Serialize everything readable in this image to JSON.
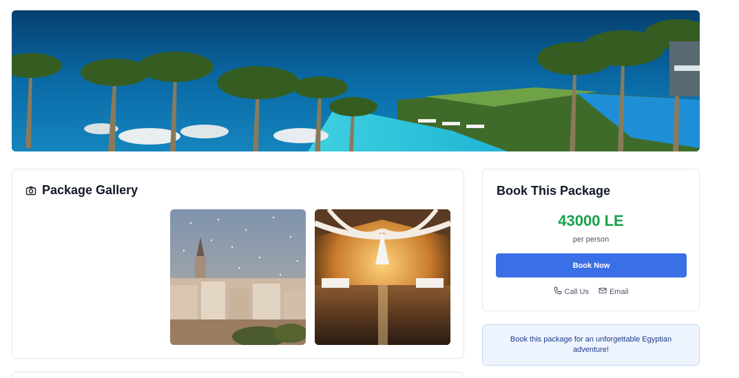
{
  "hero": {
    "image": "tropical-resort-pool-ocean-view"
  },
  "gallery": {
    "title": "Package Gallery",
    "icon": "camera-icon",
    "images": [
      "istanbul-galata-tower-city",
      "wedding-hall-chandelier-lights"
    ]
  },
  "booking": {
    "title": "Book This Package",
    "price": "43000 LE",
    "price_unit": "per person",
    "book_button": "Book Now",
    "call_label": "Call Us",
    "email_label": "Email",
    "accent_color": "#16a34a",
    "button_color": "#3b6fe6"
  },
  "note": {
    "text": "Book this package for an unforgettable Egyptian adventure!"
  }
}
